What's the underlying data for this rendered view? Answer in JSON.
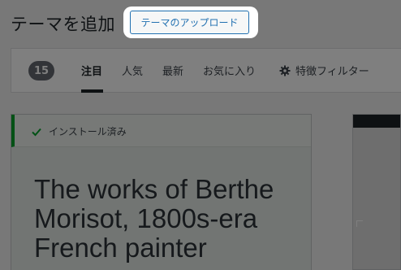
{
  "header": {
    "title": "テーマを追加",
    "upload_button_label": "テーマのアップロード"
  },
  "filter_bar": {
    "count": "15",
    "links": [
      {
        "label": "注目",
        "current": true
      },
      {
        "label": "人気",
        "current": false
      },
      {
        "label": "最新",
        "current": false
      },
      {
        "label": "お気に入り",
        "current": false
      }
    ],
    "feature_filter_label": "特徴フィルター",
    "feature_filter_icon": "gear-icon"
  },
  "theme_card": {
    "installed_notice": "インストール済み",
    "notice_icon": "check-icon",
    "preview_text": "The works of Berthe Morisot, 1800s-era French painter"
  },
  "colors": {
    "accent": "#2271b1",
    "success": "#00a32a",
    "overlay": "rgba(0,0,0,0.5)"
  }
}
